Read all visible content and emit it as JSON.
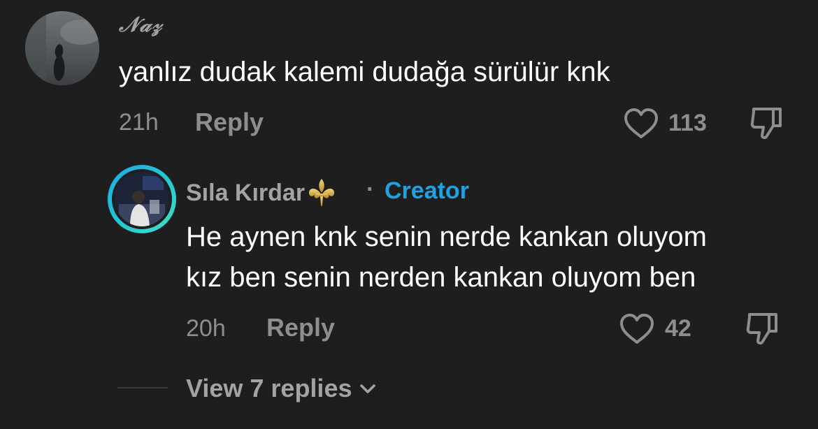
{
  "comments": [
    {
      "author": "𝒩𝒶𝓏",
      "text": "yanlız dudak kalemi dudağa sürülür knk",
      "time": "21h",
      "reply_label": "Reply",
      "likes": "113",
      "avatar_icon": "user-avatar"
    }
  ],
  "reply": {
    "author": "Sıla Kırdar",
    "badge_icon": "fleur-de-lis-icon",
    "separator": "·",
    "creator_label": "Creator",
    "text_lines": [
      "He aynen knk senin nerde kankan oluyom",
      "kız ben senin nerden kankan oluyom ben"
    ],
    "time": "20h",
    "reply_label": "Reply",
    "likes": "42",
    "avatar_ring_colors": [
      "#1fa8e8",
      "#3ee0c7"
    ]
  },
  "view_replies": {
    "label": "View 7 replies",
    "icon": "chevron-down-icon"
  },
  "colors": {
    "background": "#1e1e1e",
    "primary_text": "#ffffff",
    "secondary_text": "#8e8e8e",
    "creator_accent": "#1fa3e0"
  }
}
